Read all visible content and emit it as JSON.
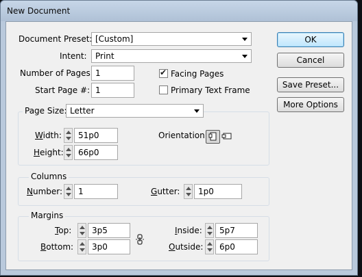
{
  "dialog": {
    "title": "New Document"
  },
  "preset": {
    "label": "Document Preset:",
    "value": "[Custom]"
  },
  "intent": {
    "label": "Intent:",
    "value": "Print"
  },
  "pages": {
    "number_label": "Number of Pages:",
    "number_value": "1",
    "start_label": "Start Page #:",
    "start_value": "1",
    "facing_label": "Facing Pages",
    "facing_checked": true,
    "primary_label": "Primary Text Frame",
    "primary_checked": false
  },
  "page_size": {
    "label": "Page Size:",
    "value": "Letter",
    "width_label": "Width:",
    "width_value": "51p0",
    "height_label": "Height:",
    "height_value": "66p0",
    "orientation_label": "Orientation:",
    "orientation_selected": "portrait"
  },
  "columns": {
    "title": "Columns",
    "number_label": "Number:",
    "number_value": "1",
    "gutter_label": "Gutter:",
    "gutter_value": "1p0"
  },
  "margins": {
    "title": "Margins",
    "top_label": "Top:",
    "top_value": "3p5",
    "bottom_label": "Bottom:",
    "bottom_value": "3p0",
    "inside_label": "Inside:",
    "inside_value": "5p7",
    "outside_label": "Outside:",
    "outside_value": "6p0",
    "link_icon": "chain-link-icon"
  },
  "buttons": {
    "ok": "OK",
    "cancel": "Cancel",
    "save_preset": "Save Preset...",
    "more_options": "More Options"
  }
}
